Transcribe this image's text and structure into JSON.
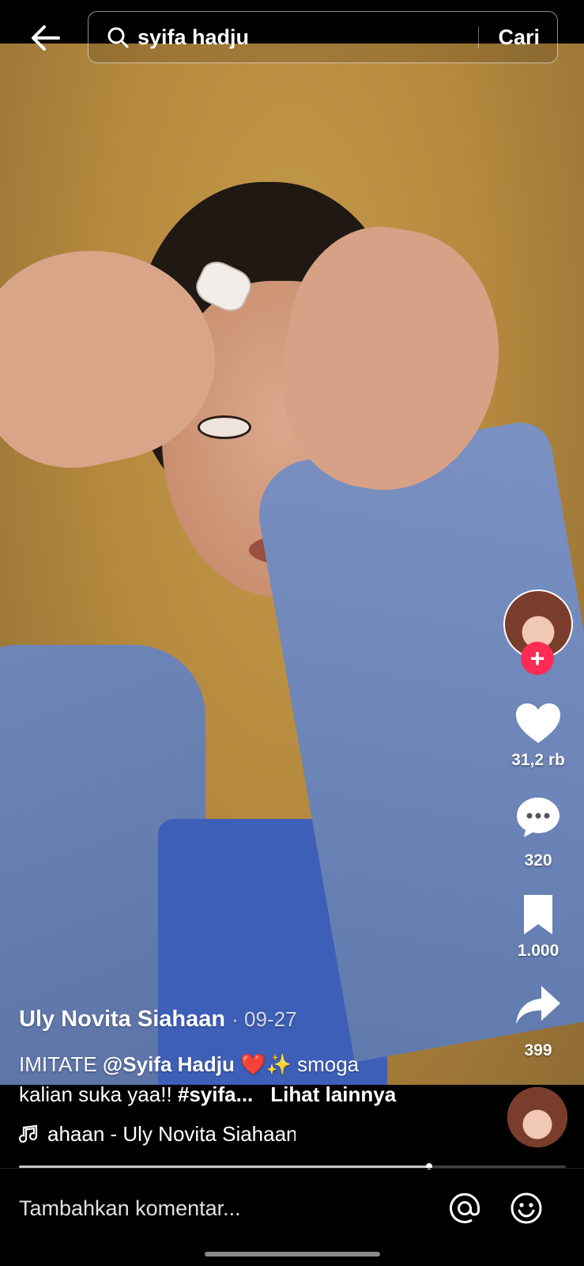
{
  "header": {
    "search_query": "syifa hadju",
    "search_button": "Cari"
  },
  "video": {
    "author": "Uly Novita Siahaan",
    "date": "· 09-27",
    "caption_line1_prefix": "IMITATE ",
    "caption_mention": "@Syifa Hadju",
    "caption_emoji": "❤️✨",
    "caption_line1_suffix": " smoga",
    "caption_line2_text": "kalian suka yaa!! ",
    "caption_hashtag": "#syifa...",
    "see_more": "Lihat lainnya",
    "music": "ahaan - Uly Novita Siahaan",
    "progress": 0.75
  },
  "actions": {
    "likes": "31,2 rb",
    "comments": "320",
    "saves": "1.000",
    "shares": "399"
  },
  "comment_bar": {
    "placeholder": "Tambahkan komentar..."
  },
  "icons": [
    "back-arrow-icon",
    "search-icon",
    "plus-icon",
    "heart-icon",
    "comment-icon",
    "bookmark-icon",
    "share-icon",
    "music-note-icon",
    "at-icon",
    "emoji-icon"
  ],
  "colors": {
    "accent": "#fe2c55",
    "background": "#000000"
  }
}
